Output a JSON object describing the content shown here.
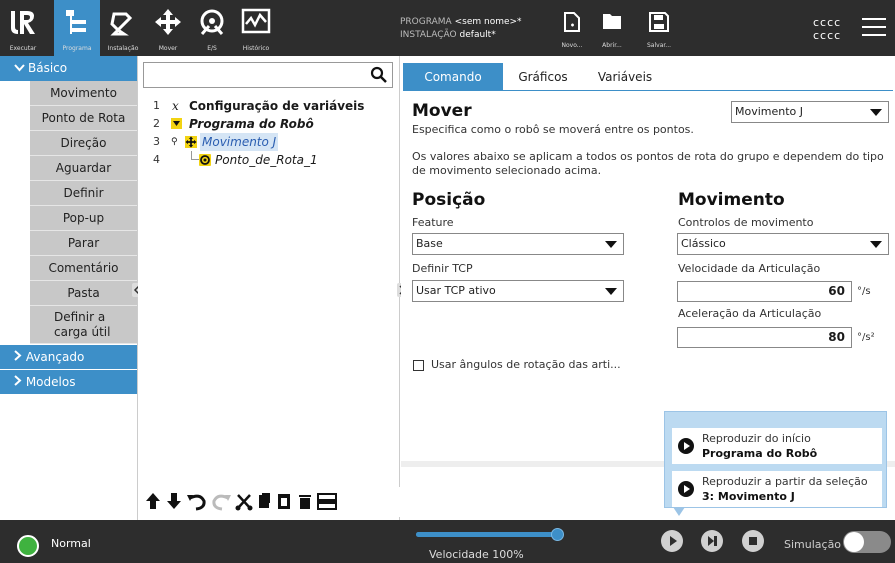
{
  "header": {
    "nav": [
      {
        "label": "Executar",
        "icon": "ur-logo-icon"
      },
      {
        "label": "Programa",
        "icon": "program-icon",
        "active": true
      },
      {
        "label": "Instalação",
        "icon": "installation-icon"
      },
      {
        "label": "Mover",
        "icon": "move-icon"
      },
      {
        "label": "E/S",
        "icon": "io-icon"
      },
      {
        "label": "Histórico",
        "icon": "log-icon"
      }
    ],
    "program_label": "PROGRAMA",
    "program_value": "<sem nome>*",
    "installation_label": "INSTALAÇÃO",
    "installation_value": "default*",
    "file_buttons": [
      {
        "label": "Novo...",
        "icon": "new-file-icon"
      },
      {
        "label": "Abrir...",
        "icon": "folder-icon"
      },
      {
        "label": "Salvar...",
        "icon": "save-icon"
      }
    ],
    "robot_line1": "cccc",
    "robot_line2": "cccc"
  },
  "palette": {
    "basic_label": "Básico",
    "items": [
      "Movimento",
      "Ponto de Rota",
      "Direção",
      "Aguardar",
      "Definir",
      "Pop-up",
      "Parar",
      "Comentário",
      "Pasta",
      "Definir a carga útil"
    ],
    "advanced_label": "Avançado",
    "templates_label": "Modelos"
  },
  "tree": {
    "search_placeholder": "",
    "rows": [
      {
        "num": "1",
        "text": "Configuração de variáveis"
      },
      {
        "num": "2",
        "text": "Programa do Robô"
      },
      {
        "num": "3",
        "text": "Movimento J"
      },
      {
        "num": "4",
        "text": "Ponto_de_Rota_1"
      }
    ]
  },
  "right": {
    "tabs": [
      "Comando",
      "Gráficos",
      "Variáveis"
    ],
    "title": "Mover",
    "move_type": "Movimento J",
    "desc1": "Especifica como o robô se moverá entre os pontos.",
    "desc2": "Os valores abaixo se aplicam a todos os pontos de rota do grupo e dependem do tipo",
    "desc3": "de movimento selecionado acima.",
    "position_heading": "Posição",
    "feature_label": "Feature",
    "feature_value": "Base",
    "tcp_label": "Definir TCP",
    "tcp_value": "Usar TCP ativo",
    "motion_heading": "Movimento",
    "motion_controls_label": "Controlos de movimento",
    "motion_controls_value": "Clássico",
    "joint_speed_label": "Velocidade da Articulação",
    "joint_speed_value": "60",
    "joint_speed_unit": "°/s",
    "joint_accel_label": "Aceleração da Articulação",
    "joint_accel_value": "80",
    "joint_accel_unit": "°/s²",
    "joint_angles_checkbox": "Usar ângulos de rotação das arti..."
  },
  "popup": {
    "play_start_title": "Reproduzir do início",
    "play_start_sub": "Programa do Robô",
    "play_sel_title": "Reproduzir a partir da seleção",
    "play_sel_sub": "3: Movimento J"
  },
  "footer": {
    "status": "Normal",
    "speed_text": "Velocidade 100%",
    "speed_fraction": 1.0,
    "simulation_label": "Simulação"
  },
  "colors": {
    "accent": "#3d8fc8",
    "header_bg": "#2d2d2d",
    "status_ok": "#3fb23f"
  }
}
